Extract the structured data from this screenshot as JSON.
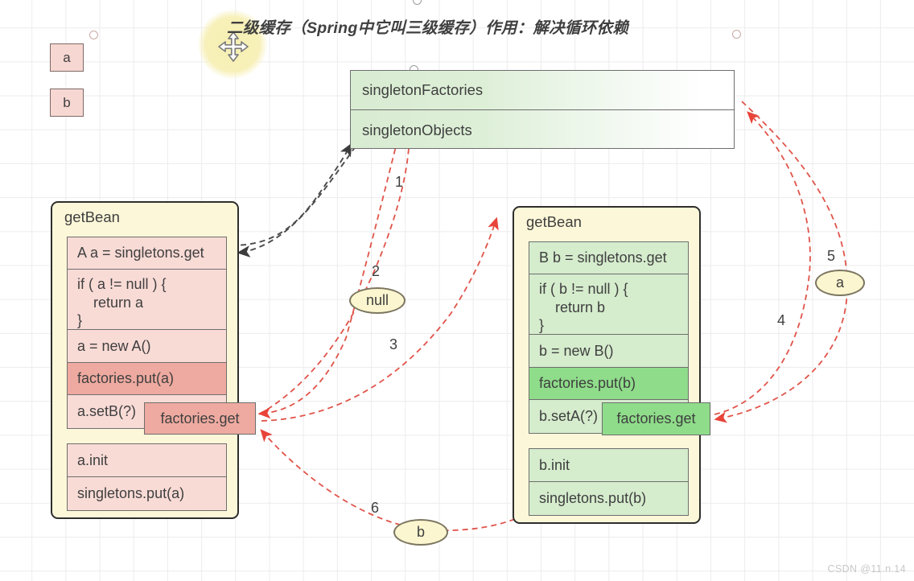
{
  "diagram": {
    "title": "二级缓存（Spring中它叫三级缓存）作用：解决循环依赖",
    "move_handle_icon": "move-icon"
  },
  "chips": [
    {
      "label": "a"
    },
    {
      "label": "b"
    }
  ],
  "cache_box": {
    "rows": [
      {
        "label": "singletonFactories"
      },
      {
        "label": "singletonObjects"
      }
    ]
  },
  "left_panel": {
    "title": "getBean",
    "group_1": [
      {
        "label": "A a = singletons.get",
        "highlight": false
      },
      {
        "label": "if ( a != null ) {\n    return a\n}",
        "highlight": false
      },
      {
        "label": "a = new A()",
        "highlight": false
      },
      {
        "label": "factories.put(a)",
        "highlight": true
      },
      {
        "label": "a.setB(?)",
        "highlight": false
      }
    ],
    "group_2": [
      {
        "label": "a.init",
        "highlight": false
      },
      {
        "label": "singletons.put(a)",
        "highlight": false
      }
    ],
    "callout": {
      "label": "factories.get"
    }
  },
  "right_panel": {
    "title": "getBean",
    "group_1": [
      {
        "label": "B b = singletons.get",
        "highlight": false
      },
      {
        "label": "if ( b != null ) {\n    return b\n}",
        "highlight": false
      },
      {
        "label": "b = new B()",
        "highlight": false
      },
      {
        "label": "factories.put(b)",
        "highlight": true
      },
      {
        "label": "b.setA(?)",
        "highlight": false
      }
    ],
    "group_2": [
      {
        "label": "b.init",
        "highlight": false
      },
      {
        "label": "singletons.put(b)",
        "highlight": false
      }
    ],
    "callout": {
      "label": "factories.get"
    }
  },
  "pills": [
    {
      "label": "null"
    },
    {
      "label": "a"
    },
    {
      "label": "b"
    }
  ],
  "steps": [
    {
      "label": "1"
    },
    {
      "label": "2"
    },
    {
      "label": "3"
    },
    {
      "label": "4"
    },
    {
      "label": "5"
    },
    {
      "label": "6"
    }
  ],
  "watermark": {
    "text": "CSDN @11.n.14"
  },
  "colors": {
    "pink_fill": "#f9dbd6",
    "pink_highlight": "#eeaaa0",
    "green_fill": "#d5eccd",
    "green_highlight": "#8fdc8a",
    "panel_yellow": "#fcf7d8",
    "red_arrow": "#e8443a",
    "dark_arrow": "#4a4a4a",
    "grid_line": "#ececec"
  }
}
